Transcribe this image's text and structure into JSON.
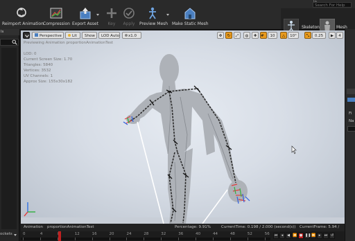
{
  "toolbar": {
    "buttons": [
      {
        "label": "Reimport Animation",
        "icon": "reimport-icon"
      },
      {
        "label": "Compression",
        "icon": "compression-icon"
      },
      {
        "label": "Export Asset",
        "icon": "export-asset-icon"
      },
      {
        "label": "Key",
        "icon": "key-icon"
      },
      {
        "label": "Apply",
        "icon": "apply-icon"
      },
      {
        "label": "Preview Mesh",
        "icon": "preview-mesh-icon"
      },
      {
        "label": "Make Static Mesh",
        "icon": "make-static-mesh-icon"
      }
    ],
    "help_fragment": "lp",
    "help_search_placeholder": "Search For Help",
    "modes": {
      "skeleton": "Skeleton",
      "mesh": "Mesh"
    }
  },
  "viewport": {
    "toolbar": {
      "perspective": "Perspective",
      "lit": "Lit",
      "show": "Show",
      "lod": "LOD Auto",
      "speed": "x1.0",
      "grid_size": "10",
      "rotation_snap": "10°",
      "scale_snap": "0.25",
      "camera_speed": "4"
    },
    "preview_title": "Previewing Animation proportionAnimationTest",
    "stats": [
      "LOD: 0",
      "Current Screen Size: 1.70",
      "Triangles: 5840",
      "Vertices: 3532",
      "UV Channels: 1",
      "Approx Size: 155x30x182"
    ]
  },
  "left_panel": {
    "tab_fragment": "ls",
    "footer_fragment": "ockets"
  },
  "right_panel": {
    "fragments": [
      "Fi",
      "Na"
    ]
  },
  "anim_bar": {
    "label": "Animation",
    "name": "proportionAnimationTest",
    "percentage": "Percentage:  9.91%",
    "current_time": "CurrentTime:  0.198 / 2.000 (second(s))",
    "current_frame": "CurrentFrame:  5.94 / 60 Frame"
  },
  "timeline": {
    "ticks": [
      "0",
      "4",
      "8",
      "12",
      "16",
      "20",
      "24",
      "28",
      "32",
      "36",
      "40",
      "44",
      "48",
      "52",
      "56"
    ],
    "current_frame_marker": 5.94,
    "total_frames": 60
  },
  "colors": {
    "accent": "#e89a1d",
    "viewport_bg": "#dfe4ec",
    "mesh": "#a9adb3"
  }
}
